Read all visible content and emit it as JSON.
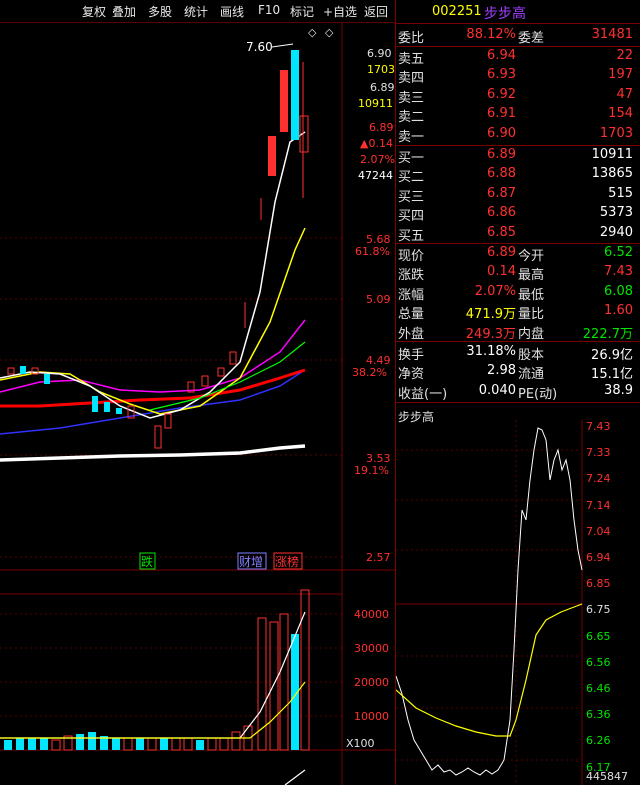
{
  "toolbar": {
    "buttons": [
      "复权",
      "叠加",
      "多股",
      "统计",
      "画线",
      "F10",
      "标记",
      "+自选",
      "返回"
    ]
  },
  "stock": {
    "code": "002251",
    "name": "步步高"
  },
  "order_book": {
    "weibi_label": "委比",
    "weibi_value": "88.12%",
    "weicha_label": "委差",
    "weicha_value": "31481",
    "sells": [
      {
        "label": "卖五",
        "price": "6.94",
        "vol": "22"
      },
      {
        "label": "卖四",
        "price": "6.93",
        "vol": "197"
      },
      {
        "label": "卖三",
        "price": "6.92",
        "vol": "47"
      },
      {
        "label": "卖二",
        "price": "6.91",
        "vol": "154"
      },
      {
        "label": "卖一",
        "price": "6.90",
        "vol": "1703"
      }
    ],
    "buys": [
      {
        "label": "买一",
        "price": "6.89",
        "vol": "10911"
      },
      {
        "label": "买二",
        "price": "6.88",
        "vol": "13865"
      },
      {
        "label": "买三",
        "price": "6.87",
        "vol": "515"
      },
      {
        "label": "买四",
        "price": "6.86",
        "vol": "5373"
      },
      {
        "label": "买五",
        "price": "6.85",
        "vol": "2940"
      }
    ]
  },
  "quote": [
    {
      "l1": "现价",
      "v1": "6.89",
      "c1": "red",
      "l2": "今开",
      "v2": "6.52",
      "c2": "green"
    },
    {
      "l1": "涨跌",
      "v1": "0.14",
      "c1": "red",
      "l2": "最高",
      "v2": "7.43",
      "c2": "red"
    },
    {
      "l1": "涨幅",
      "v1": "2.07%",
      "c1": "red",
      "l2": "最低",
      "v2": "6.08",
      "c2": "green"
    },
    {
      "l1": "总量",
      "v1": "471.9万",
      "c1": "yellow",
      "l2": "量比",
      "v2": "1.60",
      "c2": "red"
    },
    {
      "l1": "外盘",
      "v1": "249.3万",
      "c1": "red",
      "l2": "内盘",
      "v2": "222.7万",
      "c2": "green"
    }
  ],
  "stats": [
    {
      "l1": "换手",
      "v1": "31.18%",
      "l2": "股本",
      "v2": "26.9亿"
    },
    {
      "l1": "净资",
      "v1": "2.98",
      "l2": "流通",
      "v2": "15.1亿"
    },
    {
      "l1": "收益(一)",
      "v1": "0.040",
      "l2": "PE(动)",
      "v2": "38.9"
    }
  ],
  "mini_chart": {
    "title": "步步高",
    "y_labels": [
      "7.43",
      "7.33",
      "7.24",
      "7.14",
      "7.04",
      "6.94",
      "6.85",
      "6.75",
      "6.65",
      "6.56",
      "6.46",
      "6.36",
      "6.26",
      "6.17"
    ],
    "bottom_value": "445847"
  },
  "main_chart": {
    "price_labels": [
      "6.90",
      "6.89",
      "6.89",
      "5.68",
      "5.09",
      "4.49",
      "3.53",
      "2.57"
    ],
    "info_labels": [
      "1703",
      "10911",
      "0.14",
      "2.07%",
      "47244",
      "61.8%",
      "38.2%",
      "19.1%"
    ],
    "peak_label": "7.60",
    "volume_labels": [
      "40000",
      "30000",
      "20000",
      "10000"
    ],
    "volume_unit": "X100",
    "tags": [
      "跌",
      "财增",
      "涨榜"
    ]
  },
  "colors": {
    "up": "#ff3030",
    "down": "#00e6ff",
    "grid": "#7a0000",
    "ma5": "#ffffff",
    "ma10": "#ffff00",
    "ma20": "#ff00ff",
    "ma30": "#00ff00",
    "ma60": "#ff0000",
    "ma120": "#3030ff"
  }
}
